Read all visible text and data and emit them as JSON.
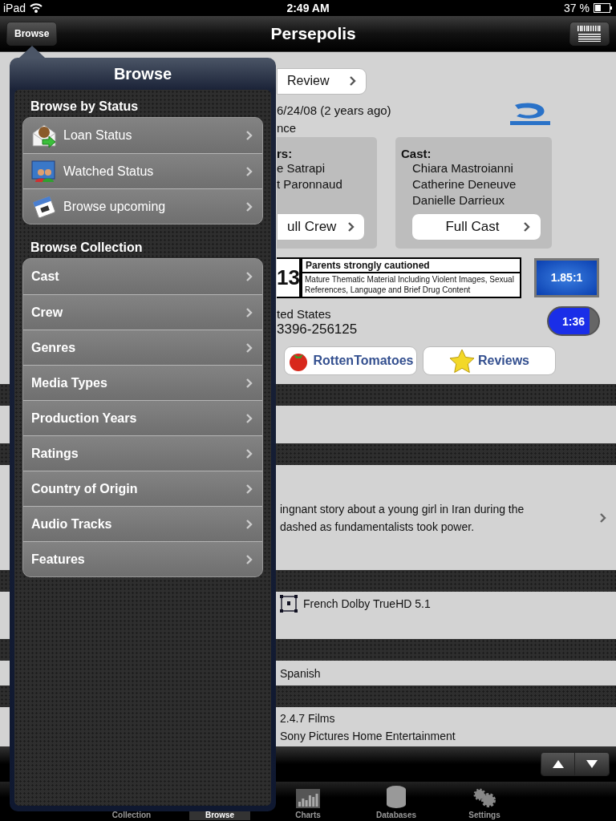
{
  "status_bar": {
    "carrier": "iPad",
    "time": "2:49 AM",
    "battery": "37 %"
  },
  "nav_bar": {
    "back_button": "Browse",
    "title": "Persepolis"
  },
  "detail": {
    "review_button": "Review",
    "release_line": "6/24/08 (2 years ago)",
    "genre_fragment": "nce",
    "crew_box": {
      "heading": "rs:",
      "names": [
        "e Satrapi",
        "t Paronnaud"
      ],
      "button": "ull Crew"
    },
    "cast_box": {
      "heading": "Cast:",
      "names": [
        "Chiara Mastroianni",
        "Catherine Deneuve",
        "Danielle Darrieux"
      ],
      "button": "Full Cast"
    },
    "rating": {
      "code_fragment": "13",
      "title": "Parents strongly cautioned",
      "reason": "Mature Thematic Material Including Violent Images, Sexual References, Language and Brief Drug Content"
    },
    "aspect_ratio": "1.85:1",
    "country_fragment": "ted States",
    "upc_fragment": "3396-256125",
    "runtime": "1:36",
    "link_buttons": [
      {
        "kind": "tomato",
        "label": "RottenTomatoes"
      },
      {
        "kind": "star",
        "label": "Reviews"
      }
    ]
  },
  "sections": [
    {
      "kind": "empty"
    },
    {
      "kind": "plot",
      "lines": [
        "ingnant story about a young girl in Iran during the",
        "dashed as fundamentalists took power."
      ]
    },
    {
      "kind": "audio",
      "lines": [
        "French Dolby TrueHD 5.1"
      ]
    },
    {
      "kind": "plain",
      "lines": [
        "Spanish"
      ]
    },
    {
      "kind": "list",
      "lines": [
        "2.4.7 Films",
        "Sony Pictures Home Entertainment"
      ]
    }
  ],
  "popover": {
    "title": "Browse",
    "groups": [
      {
        "heading": "Browse by Status",
        "items": [
          {
            "kind": "loan",
            "label": "Loan Status"
          },
          {
            "kind": "watched",
            "label": "Watched Status"
          },
          {
            "kind": "calendar",
            "label": "Browse upcoming"
          }
        ]
      },
      {
        "heading": "Browse Collection",
        "items": [
          {
            "kind": "text",
            "label": "Cast"
          },
          {
            "kind": "text",
            "label": "Crew"
          },
          {
            "kind": "text",
            "label": "Genres"
          },
          {
            "kind": "text",
            "label": "Media Types"
          },
          {
            "kind": "text",
            "label": "Production Years"
          },
          {
            "kind": "text",
            "label": "Ratings"
          },
          {
            "kind": "text",
            "label": "Country of Origin"
          },
          {
            "kind": "text",
            "label": "Audio Tracks"
          },
          {
            "kind": "text",
            "label": "Features"
          }
        ]
      }
    ]
  },
  "tab_bar": [
    {
      "kind": "collection",
      "label": "Collection",
      "selected": false
    },
    {
      "kind": "browse",
      "label": "Browse",
      "selected": true
    },
    {
      "kind": "charts",
      "label": "Charts",
      "selected": false
    },
    {
      "kind": "databases",
      "label": "Databases",
      "selected": false
    },
    {
      "kind": "settings",
      "label": "Settings",
      "selected": false
    }
  ]
}
